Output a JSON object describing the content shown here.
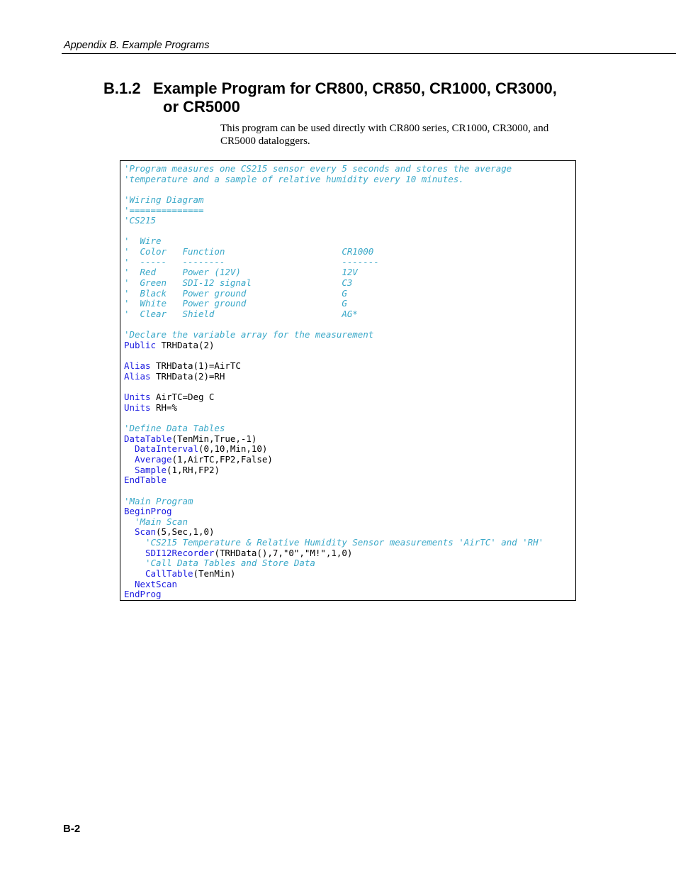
{
  "page": {
    "running_header": "Appendix B.  Example Programs",
    "page_number": "B-2"
  },
  "section": {
    "number": "B.1.2",
    "title_line1": "Example Program for CR800, CR850, CR1000, CR3000,",
    "title_line2": "or CR5000",
    "intro": "This program can be used directly with CR800 series, CR1000, CR3000, and CR5000 dataloggers."
  },
  "colors": {
    "comment": "#3aa8c8",
    "keyword": "#1a1ae0",
    "text": "#000000"
  },
  "code": {
    "lines": [
      [
        {
          "t": "comment",
          "s": "'Program measures one CS215 sensor every 5 seconds and stores the average"
        }
      ],
      [
        {
          "t": "comment",
          "s": "'temperature and a sample of relative humidity every 10 minutes."
        }
      ],
      [],
      [
        {
          "t": "comment",
          "s": "'Wiring Diagram"
        }
      ],
      [
        {
          "t": "comment",
          "s": "'=============="
        }
      ],
      [
        {
          "t": "comment",
          "s": "'CS215"
        }
      ],
      [],
      [
        {
          "t": "comment",
          "s": "'  Wire"
        }
      ],
      [
        {
          "t": "comment",
          "s": "'  Color   Function                      CR1000"
        }
      ],
      [
        {
          "t": "comment",
          "s": "'  -----   --------                      -------"
        }
      ],
      [
        {
          "t": "comment",
          "s": "'  Red     Power (12V)                   12V"
        }
      ],
      [
        {
          "t": "comment",
          "s": "'  Green   SDI-12 signal                 C3"
        }
      ],
      [
        {
          "t": "comment",
          "s": "'  Black   Power ground                  G"
        }
      ],
      [
        {
          "t": "comment",
          "s": "'  White   Power ground                  G"
        }
      ],
      [
        {
          "t": "comment",
          "s": "'  Clear   Shield                        AG*"
        }
      ],
      [],
      [
        {
          "t": "comment",
          "s": "'Declare the variable array for the measurement"
        }
      ],
      [
        {
          "t": "keyword",
          "s": "Public"
        },
        {
          "t": "plain",
          "s": " TRHData(2)"
        }
      ],
      [],
      [
        {
          "t": "keyword",
          "s": "Alias"
        },
        {
          "t": "plain",
          "s": " TRHData(1)=AirTC"
        }
      ],
      [
        {
          "t": "keyword",
          "s": "Alias"
        },
        {
          "t": "plain",
          "s": " TRHData(2)=RH"
        }
      ],
      [],
      [
        {
          "t": "keyword",
          "s": "Units"
        },
        {
          "t": "plain",
          "s": " AirTC=Deg C"
        }
      ],
      [
        {
          "t": "keyword",
          "s": "Units"
        },
        {
          "t": "plain",
          "s": " RH=%"
        }
      ],
      [],
      [
        {
          "t": "comment",
          "s": "'Define Data Tables"
        }
      ],
      [
        {
          "t": "keyword",
          "s": "DataTable"
        },
        {
          "t": "plain",
          "s": "(TenMin,True,-1)"
        }
      ],
      [
        {
          "t": "plain",
          "s": "  "
        },
        {
          "t": "keyword",
          "s": "DataInterval"
        },
        {
          "t": "plain",
          "s": "(0,10,Min,10)"
        }
      ],
      [
        {
          "t": "plain",
          "s": "  "
        },
        {
          "t": "keyword",
          "s": "Average"
        },
        {
          "t": "plain",
          "s": "(1,AirTC,FP2,False)"
        }
      ],
      [
        {
          "t": "plain",
          "s": "  "
        },
        {
          "t": "keyword",
          "s": "Sample"
        },
        {
          "t": "plain",
          "s": "(1,RH,FP2)"
        }
      ],
      [
        {
          "t": "keyword",
          "s": "EndTable"
        }
      ],
      [],
      [
        {
          "t": "comment",
          "s": "'Main Program"
        }
      ],
      [
        {
          "t": "keyword",
          "s": "BeginProg"
        }
      ],
      [
        {
          "t": "plain",
          "s": "  "
        },
        {
          "t": "comment",
          "s": "'Main Scan"
        }
      ],
      [
        {
          "t": "plain",
          "s": "  "
        },
        {
          "t": "keyword",
          "s": "Scan"
        },
        {
          "t": "plain",
          "s": "(5,Sec,1,0)"
        }
      ],
      [
        {
          "t": "plain",
          "s": "    "
        },
        {
          "t": "comment",
          "s": "'CS215 Temperature & Relative Humidity Sensor measurements 'AirTC' and 'RH'"
        }
      ],
      [
        {
          "t": "plain",
          "s": "    "
        },
        {
          "t": "keyword",
          "s": "SDI12Recorder"
        },
        {
          "t": "plain",
          "s": "(TRHData(),7,\"0\",\"M!\",1,0)"
        }
      ],
      [
        {
          "t": "plain",
          "s": "    "
        },
        {
          "t": "comment",
          "s": "'Call Data Tables and Store Data"
        }
      ],
      [
        {
          "t": "plain",
          "s": "    "
        },
        {
          "t": "keyword",
          "s": "CallTable"
        },
        {
          "t": "plain",
          "s": "(TenMin)"
        }
      ],
      [
        {
          "t": "plain",
          "s": "  "
        },
        {
          "t": "keyword",
          "s": "NextScan"
        }
      ],
      [
        {
          "t": "keyword",
          "s": "EndProg"
        }
      ]
    ]
  }
}
